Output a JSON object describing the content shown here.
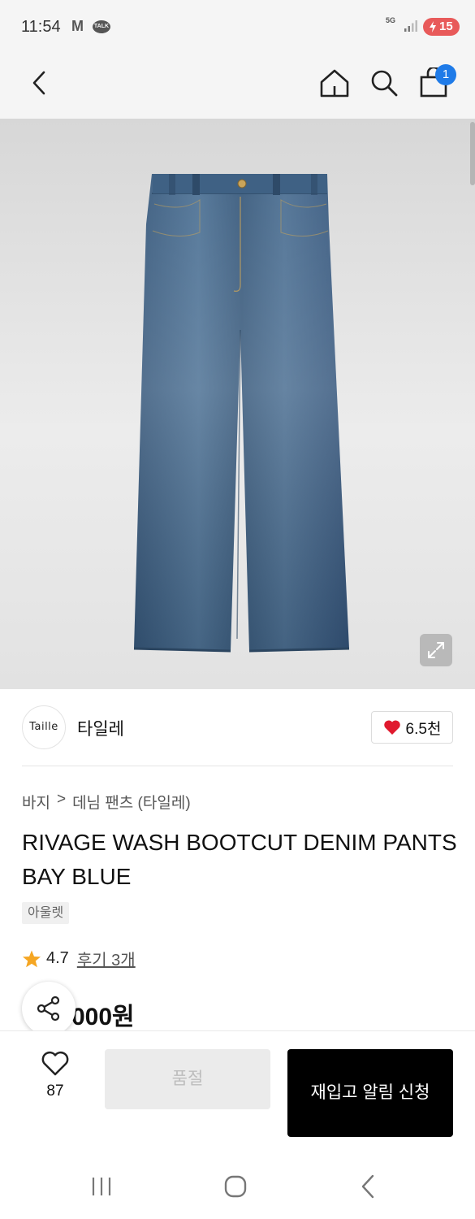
{
  "status_bar": {
    "time": "11:54",
    "gmail_icon": "M",
    "talk_icon": "TALK",
    "network": "5G",
    "battery": "15"
  },
  "nav": {
    "cart_count": "1"
  },
  "brand": {
    "logo_text": "Taille",
    "name": "타일레",
    "like_count": "6.5천"
  },
  "breadcrumb": {
    "category": "바지",
    "separator": ">",
    "subcategory": "데님 팬츠 (타일레)"
  },
  "product": {
    "title": "RIVAGE WASH BOOTCUT DENIM PANTS BAY BLUE",
    "tag": "아울렛",
    "rating": "4.7",
    "review_link": "후기 3개",
    "price_partial": "000원"
  },
  "bottom_bar": {
    "wish_count": "87",
    "soldout_label": "품절",
    "restock_label": "재입고 알림 신청"
  },
  "colors": {
    "accent_blue": "#1f7be8",
    "star": "#f5a623",
    "heart": "#e0192e",
    "cta_black": "#000000",
    "denim": "#3e5f80"
  }
}
